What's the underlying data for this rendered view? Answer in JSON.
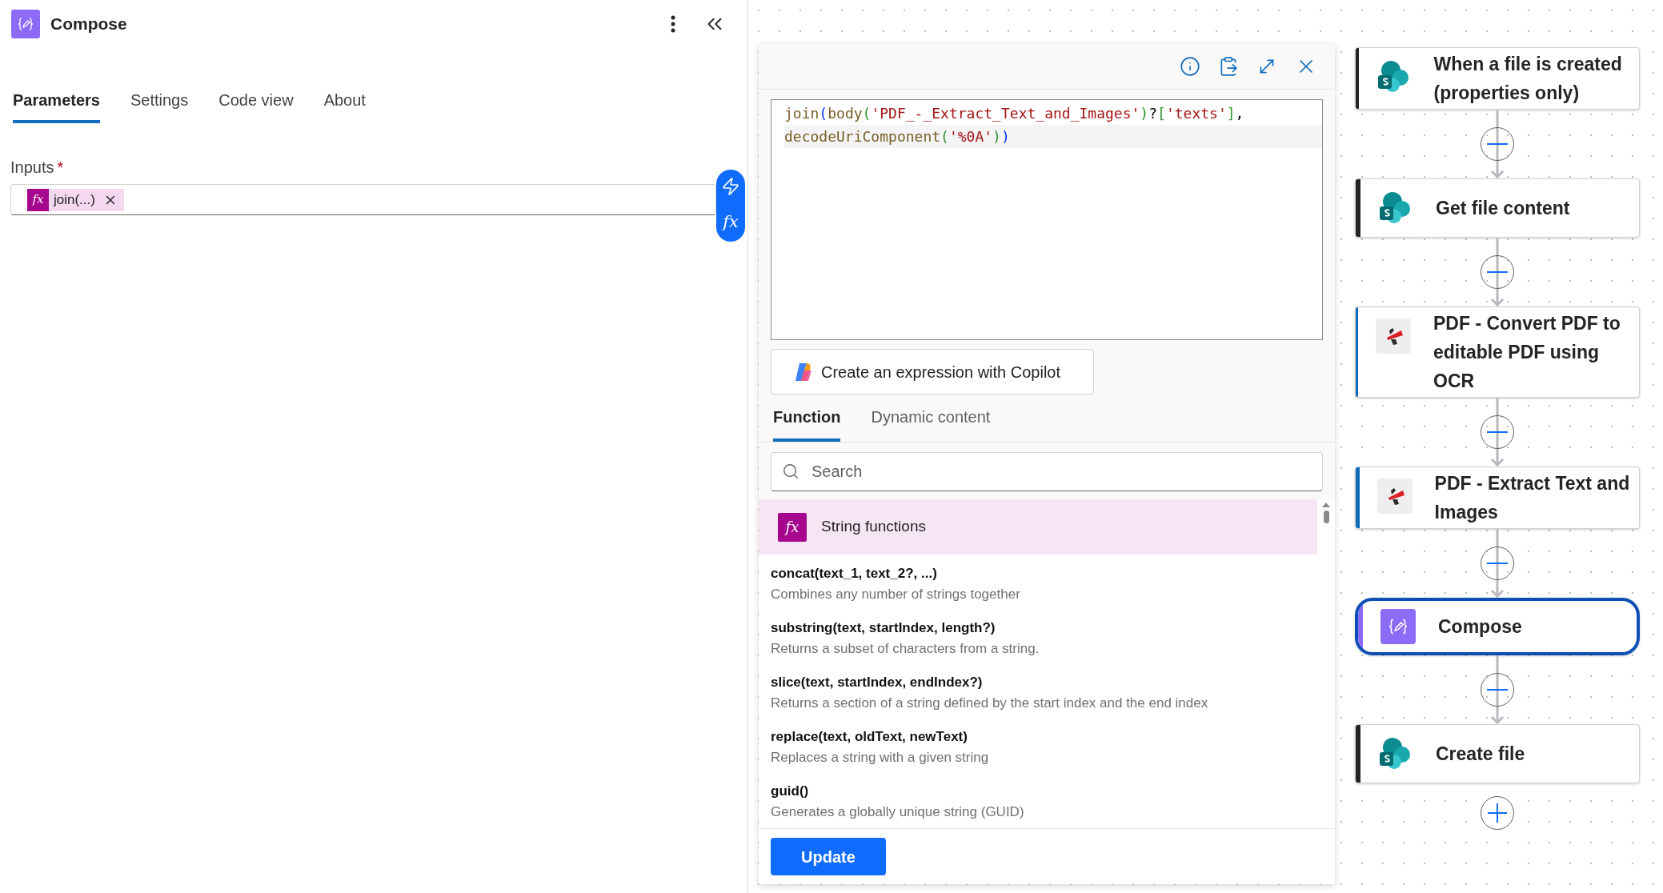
{
  "panel": {
    "title": "Compose",
    "tabs": [
      {
        "label": "Parameters",
        "selected": true
      },
      {
        "label": "Settings",
        "selected": false
      },
      {
        "label": "Code view",
        "selected": false
      },
      {
        "label": "About",
        "selected": false
      }
    ],
    "inputs": {
      "label": "Inputs",
      "required_mark": "*",
      "token": {
        "symbol": "fx",
        "label": "join(...)"
      }
    },
    "side_buttons": [
      {
        "kind": "dynamic"
      },
      {
        "kind": "expression",
        "symbol": "fx"
      }
    ]
  },
  "expression_editor": {
    "code_lines": [
      [
        {
          "text": "join",
          "kind": "fn"
        },
        {
          "text": "(",
          "kind": "bracket1"
        },
        {
          "text": "body",
          "kind": "fn"
        },
        {
          "text": "(",
          "kind": "bracket2"
        },
        {
          "text": "'PDF_-_Extract_Text_and_Images'",
          "kind": "string"
        },
        {
          "text": ")",
          "kind": "bracket2"
        },
        {
          "text": "?",
          "kind": "punct"
        },
        {
          "text": "[",
          "kind": "bracket2"
        },
        {
          "text": "'texts'",
          "kind": "string"
        },
        {
          "text": "]",
          "kind": "bracket2"
        },
        {
          "text": ",",
          "kind": "punct"
        }
      ],
      [
        {
          "text": "decodeUriComponent",
          "kind": "fn"
        },
        {
          "text": "(",
          "kind": "bracket2"
        },
        {
          "text": "'%0A'",
          "kind": "string"
        },
        {
          "text": ")",
          "kind": "bracket2"
        },
        {
          "text": ")",
          "kind": "bracket1"
        }
      ]
    ],
    "copilot_button": "Create an expression with Copilot",
    "tabs": [
      {
        "label": "Function",
        "selected": true
      },
      {
        "label": "Dynamic content",
        "selected": false
      }
    ],
    "search": {
      "placeholder": "Search"
    },
    "group": {
      "symbol": "fx",
      "title": "String functions"
    },
    "functions": [
      {
        "name": "concat(text_1, text_2?, ...)",
        "description": "Combines any number of strings together"
      },
      {
        "name": "substring(text, startIndex, length?)",
        "description": "Returns a subset of characters from a string."
      },
      {
        "name": "slice(text, startIndex, endIndex?)",
        "description": "Returns a section of a string defined by the start index and the end index"
      },
      {
        "name": "replace(text, oldText, newText)",
        "description": "Replaces a string with a given string"
      },
      {
        "name": "guid()",
        "description": "Generates a globally unique string (GUID)"
      }
    ],
    "update_button": "Update"
  },
  "flow": [
    {
      "kind": "sharepoint",
      "title": "When a file is created (properties only)",
      "selected": false
    },
    {
      "kind": "sharepoint",
      "title": "Get file content",
      "selected": false
    },
    {
      "kind": "pdf",
      "title": "PDF - Convert PDF to editable PDF using OCR",
      "selected": false
    },
    {
      "kind": "pdf",
      "title": "PDF - Extract Text and Images",
      "selected": false
    },
    {
      "kind": "compose",
      "title": "Compose",
      "selected": true
    },
    {
      "kind": "sharepoint",
      "title": "Create file",
      "selected": false
    }
  ]
}
